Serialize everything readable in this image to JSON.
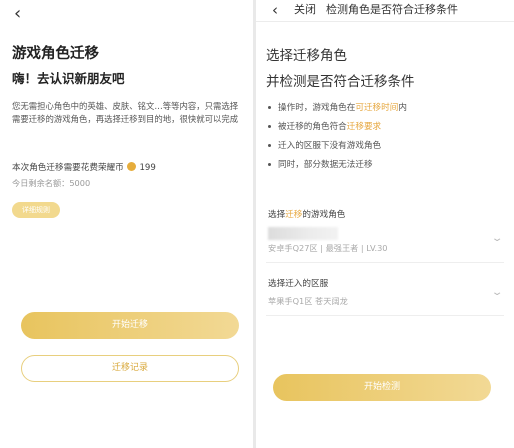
{
  "left": {
    "back_glyph": "‹",
    "title": "游戏角色迁移",
    "subtitle": "嗨！去认识新朋友吧",
    "description": "您无需担心角色中的英雄、皮肤、铭文…等等内容，只需选择需要迁移的游戏角色，再选择迁移到目的地，很快就可以完成",
    "cost_text": "本次角色迁移需要花费荣耀币",
    "cost_value": "199",
    "remaining": "今日剩余名额：5000",
    "detail_button": "详细规则",
    "start_button": "开始迁移",
    "record_button": "迁移记录"
  },
  "right": {
    "back_glyph": "‹",
    "close_label": "关闭",
    "top_title": "检测角色是否符合迁移条件",
    "heading1": "选择迁移角色",
    "heading2": "并检测是否符合迁移条件",
    "rules": [
      {
        "pre": "操作时，游戏角色在",
        "hl": "可迁移时间",
        "post": "内"
      },
      {
        "pre": "被迁移的角色符合",
        "hl": "迁移要求",
        "post": ""
      },
      {
        "pre": "迁入的区服下没有游戏角色",
        "hl": "",
        "post": ""
      },
      {
        "pre": "同时，部分数据无法迁移",
        "hl": "",
        "post": ""
      }
    ],
    "select_role_pre": "选择",
    "select_role_hl": "迁移",
    "select_role_post": "的游戏角色",
    "role_value": "安卓手Q27区 | 最强王者 | LV.30",
    "select_server_label": "选择迁入的区服",
    "server_value": "苹果手Q1区 苍天阔龙",
    "check_button": "开始检测"
  },
  "colors": {
    "accent": "#e8c45e",
    "highlight": "#e6a63c"
  },
  "icons": {
    "back": "back-arrow-icon",
    "coin": "coin-icon",
    "dropdown": "chevron-down-icon"
  }
}
